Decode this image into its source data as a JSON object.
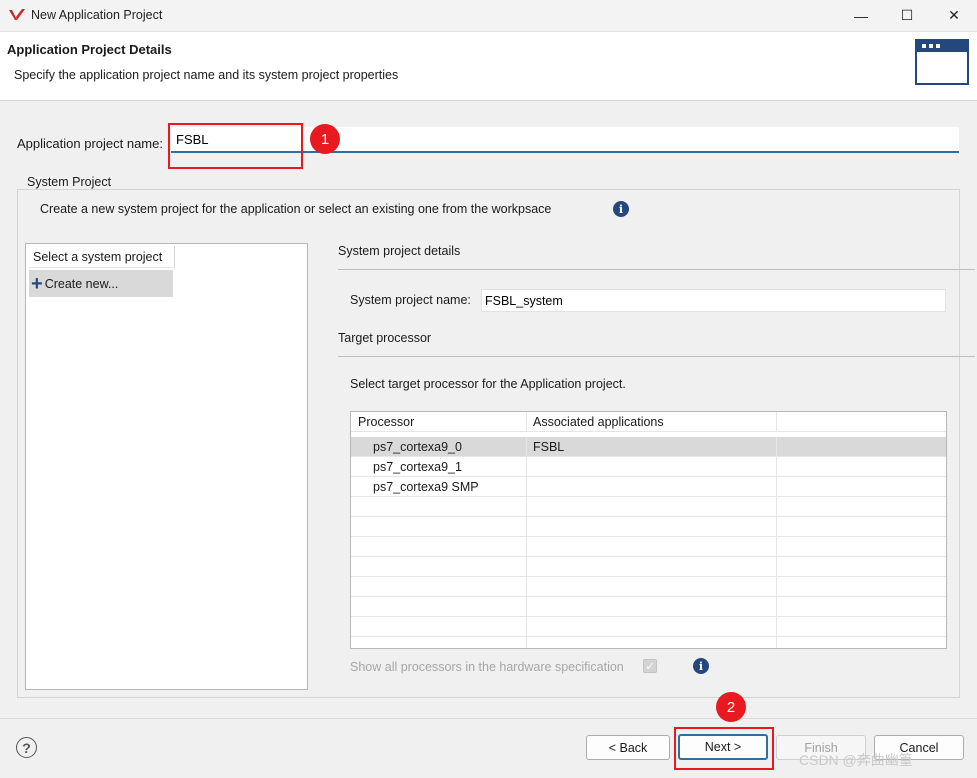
{
  "window": {
    "title": "New Application Project",
    "controls": [
      "—",
      "☐",
      "✕"
    ]
  },
  "header": {
    "title": "Application Project Details",
    "subtitle": "Specify the application project name and its system project properties"
  },
  "app_project": {
    "label": "Application project name:",
    "value": "FSBL"
  },
  "annotations": {
    "marker1": "1",
    "marker2": "2"
  },
  "system_project": {
    "group_label": "System Project",
    "description": "Create a new system project for the application or select an existing one from the workpsace",
    "list_header": "Select a system project",
    "create_new": "Create new..."
  },
  "details": {
    "section_title": "System project details",
    "name_label": "System project name:",
    "name_value": "FSBL_system",
    "target_title": "Target processor",
    "target_desc": "Select target processor for the Application project.",
    "columns": [
      "Processor",
      "Associated applications",
      ""
    ],
    "rows": [
      {
        "processor": "ps7_cortexa9_0",
        "apps": "FSBL"
      },
      {
        "processor": "ps7_cortexa9_1",
        "apps": ""
      },
      {
        "processor": "ps7_cortexa9 SMP",
        "apps": ""
      }
    ],
    "show_all_label": "Show all processors in the hardware specification",
    "show_all_checked": true
  },
  "footer": {
    "help": "?",
    "back": "< Back",
    "next": "Next >",
    "finish": "Finish",
    "cancel": "Cancel"
  },
  "watermark": "CSDN @奔曲幽篁",
  "colors": {
    "accent": "#2f6ea3",
    "annotation_red": "#e8191f",
    "info_blue": "#24487e",
    "selection": "#d9d9d9"
  }
}
